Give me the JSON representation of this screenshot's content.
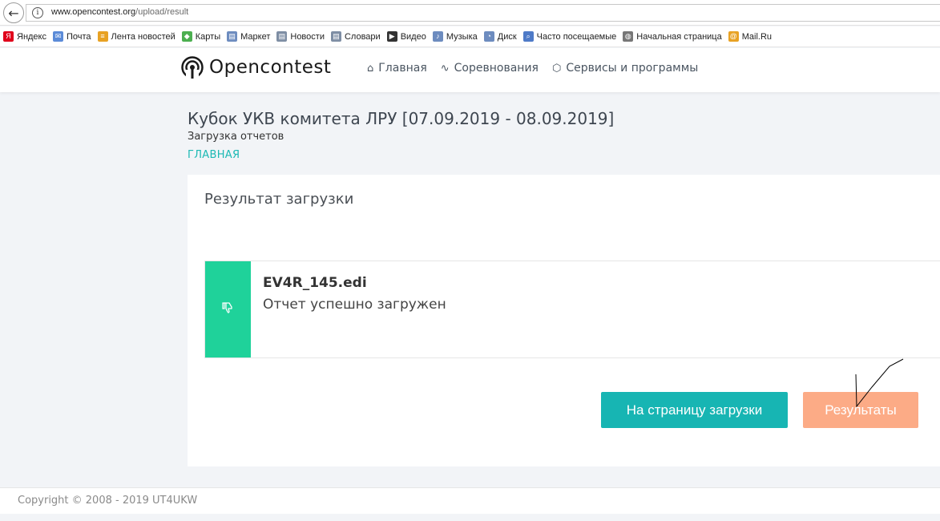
{
  "browser": {
    "url_domain": "www.opencontest.org",
    "url_path": "/upload/result",
    "bookmarks": [
      {
        "label": "Яндекс",
        "icon": "yandex-icon",
        "color": "#e0001b",
        "glyph": "Я"
      },
      {
        "label": "Почта",
        "icon": "mail-icon",
        "color": "#5b8bd8",
        "glyph": "✉"
      },
      {
        "label": "Лента новостей",
        "icon": "rss-icon",
        "color": "#e8a224",
        "glyph": "≡"
      },
      {
        "label": "Карты",
        "icon": "map-icon",
        "color": "#4caf50",
        "glyph": "◆"
      },
      {
        "label": "Маркет",
        "icon": "market-icon",
        "color": "#6d8cbf",
        "glyph": "▤"
      },
      {
        "label": "Новости",
        "icon": "news-icon",
        "color": "#7e8ea4",
        "glyph": "▤"
      },
      {
        "label": "Словари",
        "icon": "dictionary-icon",
        "color": "#7e8ea4",
        "glyph": "▤"
      },
      {
        "label": "Видео",
        "icon": "video-icon",
        "color": "#333333",
        "glyph": "▶"
      },
      {
        "label": "Музыка",
        "icon": "music-icon",
        "color": "#6d8cbf",
        "glyph": "♪"
      },
      {
        "label": "Диск",
        "icon": "disk-icon",
        "color": "#6d8cbf",
        "glyph": "◔"
      },
      {
        "label": "Часто посещаемые",
        "icon": "frequent-icon",
        "color": "#4e7ac7",
        "glyph": "⌕"
      },
      {
        "label": "Начальная страница",
        "icon": "globe-icon",
        "color": "#777777",
        "glyph": "◍"
      },
      {
        "label": "Mail.Ru",
        "icon": "mailru-icon",
        "color": "#e8a224",
        "glyph": "@"
      }
    ]
  },
  "header": {
    "logo_text": "Opencontest",
    "nav": [
      {
        "label": "Главная",
        "icon": "home-icon",
        "glyph": "⌂"
      },
      {
        "label": "Соревнования",
        "icon": "activity-icon",
        "glyph": "∿"
      },
      {
        "label": "Сервисы и программы",
        "icon": "box-icon",
        "glyph": "⬡"
      }
    ]
  },
  "page": {
    "title": "Кубок УКВ комитета ЛРУ [07.09.2019 - 08.09.2019]",
    "subtitle": "Загрузка отчетов",
    "breadcrumb": "ГЛАВНАЯ"
  },
  "card": {
    "title": "Результат загрузки",
    "result": {
      "filename": "EV4R_145.edi",
      "message": "Отчет успешно загружен",
      "status_color": "#1fd29a"
    },
    "buttons": {
      "upload_page": "На страницу загрузки",
      "results": "Результаты"
    }
  },
  "footer": {
    "copyright": "Copyright © 2008 - 2019 UT4UKW"
  }
}
